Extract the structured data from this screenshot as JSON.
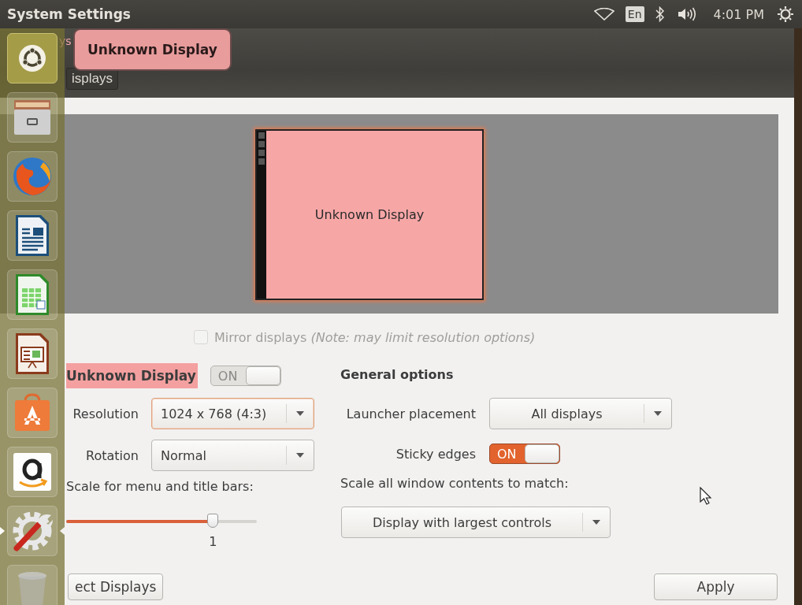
{
  "top_panel": {
    "title": "System Settings",
    "keyboard_layout": "En",
    "time": "4:01 PM"
  },
  "launcher": {
    "items": [
      {
        "kind": "dash",
        "selected": true,
        "running": false
      },
      {
        "kind": "files",
        "selected": false,
        "running": false
      },
      {
        "kind": "browser",
        "selected": false,
        "running": false
      },
      {
        "kind": "writer",
        "selected": false,
        "running": false
      },
      {
        "kind": "calc",
        "selected": false,
        "running": false
      },
      {
        "kind": "impress",
        "selected": false,
        "running": false
      },
      {
        "kind": "software",
        "selected": false,
        "running": false
      },
      {
        "kind": "shop",
        "selected": false,
        "running": false
      },
      {
        "kind": "settings",
        "selected": false,
        "running": true
      },
      {
        "kind": "trash",
        "selected": false,
        "running": false
      }
    ]
  },
  "header": {
    "heading": "ys",
    "breadcrumb": "isplays"
  },
  "tooltip": "Unknown Display",
  "preview": {
    "display_label": "Unknown Display"
  },
  "mirror": {
    "label": "Mirror displays *(Note: may limit resolution options)*",
    "checked": false,
    "disabled": true
  },
  "display": {
    "name": "Unknown Display",
    "switch": {
      "label": "ON",
      "on": true,
      "disabled": true
    },
    "resolution": {
      "label": "Resolution",
      "value": "1024 x 768 (4:3)",
      "focused": true
    },
    "rotation": {
      "label": "Rotation",
      "value": "Normal",
      "focused": false
    },
    "scale": {
      "label": "Scale for menu and title bars:",
      "level": 0.77,
      "reading": "1"
    }
  },
  "general": {
    "heading": "General options",
    "launcher_placement": {
      "label": "Launcher placement",
      "value": "All displays",
      "focused": false
    },
    "sticky_edges": {
      "label": "Sticky edges",
      "switch": {
        "label": "ON",
        "on": true,
        "disabled": false
      }
    },
    "scale_all": {
      "label": "Scale all window contents to match:",
      "value": "Display with largest controls",
      "focused": false
    }
  },
  "buttons": {
    "detect": "ect Displays",
    "apply": "Apply"
  }
}
